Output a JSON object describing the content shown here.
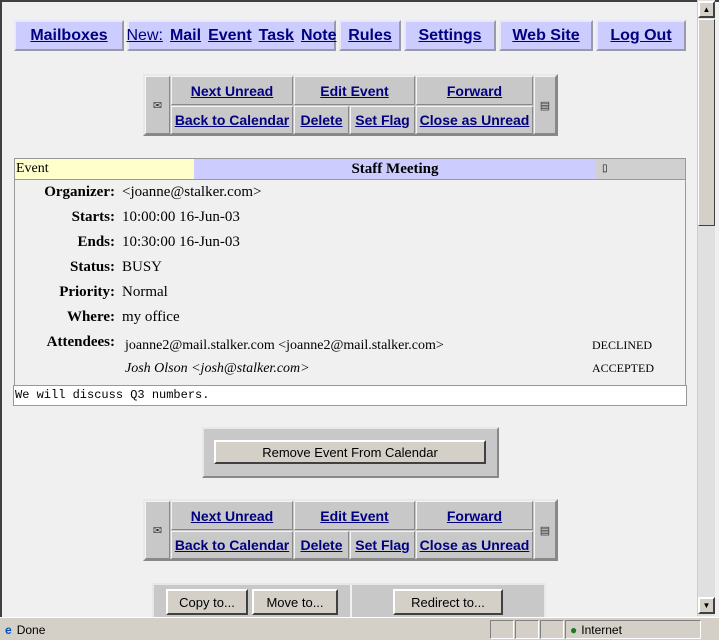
{
  "nav": {
    "mailboxes": "Mailboxes",
    "new_label": "New:",
    "new_items": [
      "Mail",
      "Event",
      "Task",
      "Note"
    ],
    "rules": "Rules",
    "settings": "Settings",
    "web_site": "Web Site",
    "log_out": "Log Out"
  },
  "toolbar": {
    "next_unread": "Next Unread",
    "edit_event": "Edit Event",
    "forward": "Forward",
    "back_to_calendar": "Back to Calendar",
    "delete": "Delete",
    "set_flag": "Set Flag",
    "close_as_unread": "Close as Unread"
  },
  "event": {
    "type_label": "Event",
    "title": "Staff Meeting",
    "fields": [
      {
        "label": "Organizer:",
        "value": "<joanne@stalker.com>"
      },
      {
        "label": "Starts:",
        "value": "10:00:00 16-Jun-03"
      },
      {
        "label": "Ends:",
        "value": "10:30:00 16-Jun-03"
      },
      {
        "label": "Status:",
        "value": "BUSY"
      },
      {
        "label": "Priority:",
        "value": "Normal"
      },
      {
        "label": "Where:",
        "value": "my office"
      }
    ],
    "attendees_label": "Attendees:",
    "attendees": [
      {
        "name": "joanne2@mail.stalker.com <joanne2@mail.stalker.com>",
        "status": "DECLINED"
      },
      {
        "name": "Josh Olson <josh@stalker.com>",
        "status": "ACCEPTED"
      }
    ],
    "body": "We will discuss Q3 numbers."
  },
  "actions": {
    "remove": "Remove Event From Calendar",
    "copy": "Copy to...",
    "move": "Move to...",
    "redirect": "Redirect to..."
  },
  "status_bar": {
    "text": "Done",
    "zone": "Internet"
  }
}
